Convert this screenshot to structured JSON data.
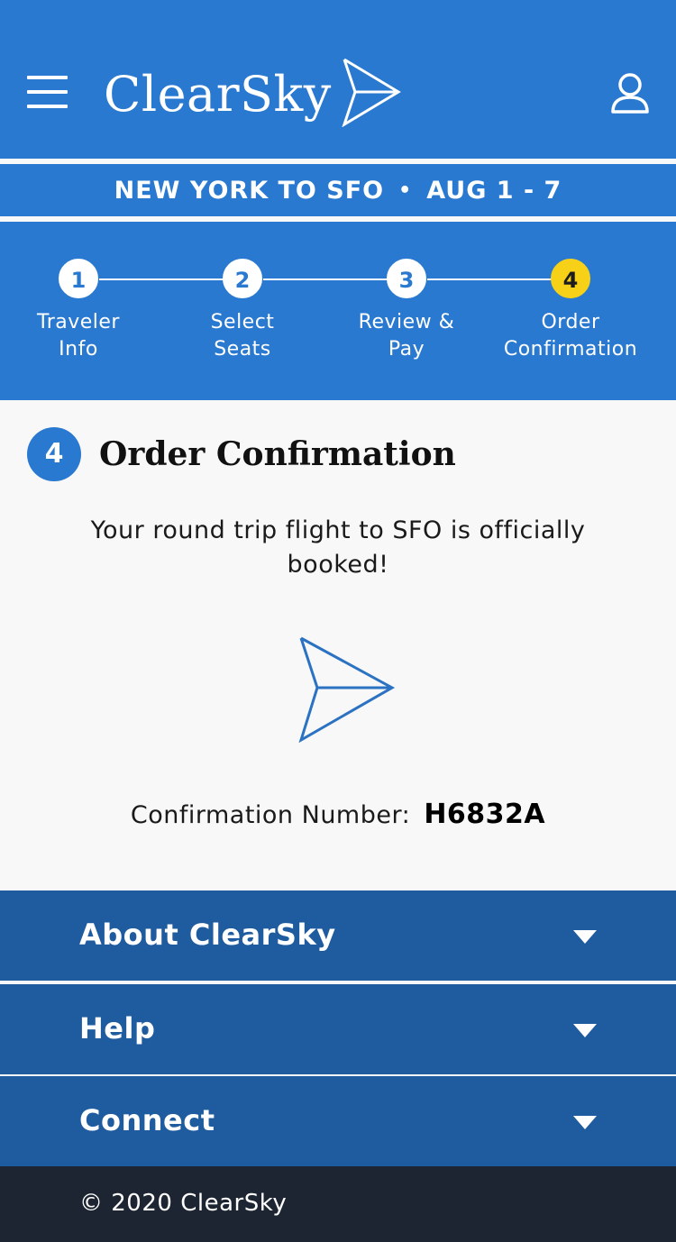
{
  "header": {
    "brand": "ClearSky",
    "menu_icon": "hamburger-menu-icon",
    "logo_icon": "paper-plane-icon",
    "account_icon": "user-account-icon",
    "background_color": "#2979d0"
  },
  "trip": {
    "route": "NEW YORK TO SFO",
    "separator": "•",
    "dates": "AUG 1 - 7"
  },
  "steps": [
    {
      "number": "1",
      "label": "Traveler Info",
      "state": "completed"
    },
    {
      "number": "2",
      "label": "Select Seats",
      "state": "completed"
    },
    {
      "number": "3",
      "label": "Review & Pay",
      "state": "completed"
    },
    {
      "number": "4",
      "label": "Order Confirmation",
      "state": "active"
    }
  ],
  "active_step_color": "#f7d117",
  "confirmation": {
    "step_number": "4",
    "title": "Order Confirmation",
    "message": "Your round trip flight to SFO is officially booked!",
    "illustration_icon": "paper-plane-icon",
    "number_label": "Confirmation Number:",
    "number_value": "H6832A"
  },
  "footer_sections": [
    {
      "label": "About ClearSky",
      "icon": "chevron-down-icon"
    },
    {
      "label": "Help",
      "icon": "chevron-down-icon"
    },
    {
      "label": "Connect",
      "icon": "chevron-down-icon"
    }
  ],
  "footer_section_color": "#1f5b9f",
  "footer": {
    "copyright": "© 2020 ClearSky",
    "background_color": "#1c2531"
  }
}
